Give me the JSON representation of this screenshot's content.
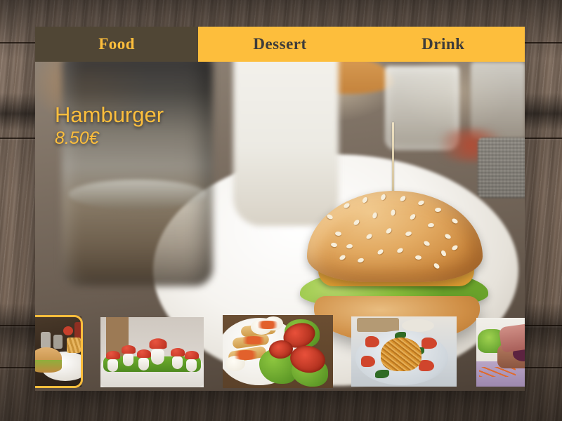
{
  "app": {
    "type": "restaurant-menu-card",
    "background": "wooden-table-photo"
  },
  "nav": {
    "tabs": [
      {
        "label": "Food",
        "active": true,
        "name": "tab-food"
      },
      {
        "label": "Dessert",
        "active": false,
        "name": "tab-dessert"
      },
      {
        "label": "Drink",
        "active": false,
        "name": "tab-drink"
      }
    ],
    "accent_color": "#fdbe3c",
    "active_tab_bg": "#383634",
    "inactive_text_color": "#3e3c3a"
  },
  "hero": {
    "dish_name": "Hamburger",
    "price": "8.50€",
    "text_color": "#fdbe3c",
    "image_alt": "hamburger-on-white-plate"
  },
  "thumbnails": {
    "selected_index": 0,
    "selection_border_color": "#fdbe3c",
    "items": [
      {
        "name": "thumbnail-hamburger",
        "alt": "hamburger-on-plate-with-fries",
        "selected": true
      },
      {
        "name": "thumbnail-mushroom-eggs",
        "alt": "egg-mushroom-appetizers-on-greens",
        "selected": false
      },
      {
        "name": "thumbnail-egg-salad",
        "alt": "egg-toast-with-tomato-and-lettuce",
        "selected": false
      },
      {
        "name": "thumbnail-pasta",
        "alt": "spaghetti-nest-with-tomato-and-basil",
        "selected": false
      },
      {
        "name": "thumbnail-roast-meat",
        "alt": "sliced-roast-meat-with-broccoli",
        "selected": false
      }
    ]
  }
}
